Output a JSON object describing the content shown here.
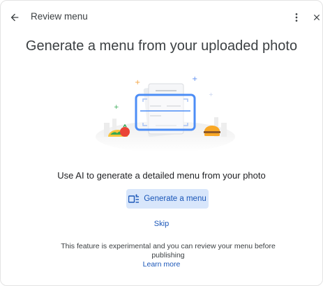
{
  "header": {
    "title": "Review menu",
    "back_icon": "arrow-back-icon",
    "more_icon": "more-vert-icon",
    "close_icon": "close-icon"
  },
  "main": {
    "heading": "Generate a menu from your uploaded photo",
    "illustration": "menu-scan-illustration",
    "subtitle": "Use AI to generate a detailed menu from your photo",
    "generate_button": {
      "label": "Generate a menu",
      "icon": "generate-menu-icon"
    },
    "skip_label": "Skip",
    "note": "This feature is experimental and you can review your menu before publishing",
    "learn_more_label": "Learn more"
  },
  "colors": {
    "accent": "#1a56b8",
    "button_bg": "#d8e6fb",
    "text": "#202124"
  }
}
